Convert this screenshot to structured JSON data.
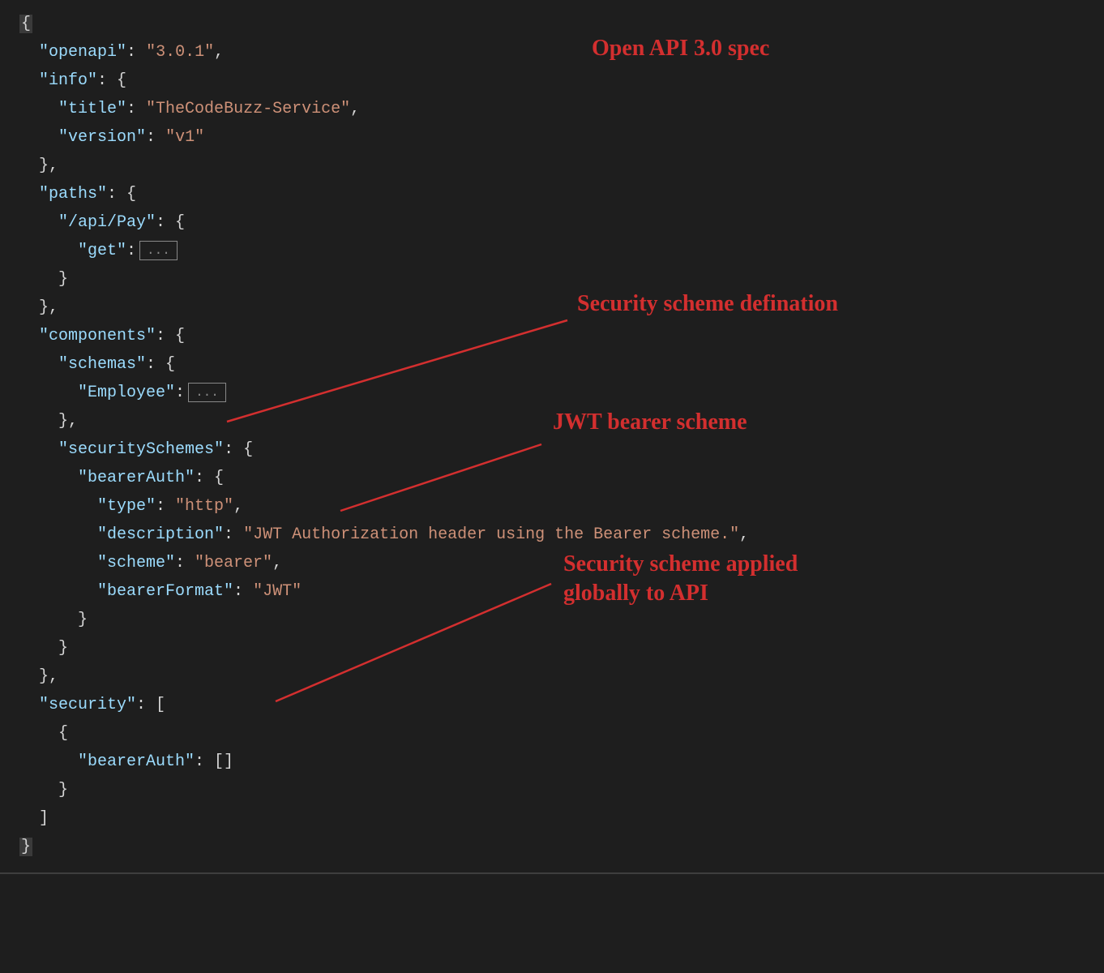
{
  "code": {
    "line1": "{",
    "line2_key": "\"openapi\"",
    "line2_val": "\"3.0.1\"",
    "line3_key": "\"info\"",
    "line4_key": "\"title\"",
    "line4_val": "\"TheCodeBuzz-Service\"",
    "line5_key": "\"version\"",
    "line5_val": "\"v1\"",
    "line7_key": "\"paths\"",
    "line8_key": "\"/api/Pay\"",
    "line9_key": "\"get\"",
    "collapsed": "...",
    "line12_key": "\"components\"",
    "line13_key": "\"schemas\"",
    "line14_key": "\"Employee\"",
    "line16_key": "\"securitySchemes\"",
    "line17_key": "\"bearerAuth\"",
    "line18_key": "\"type\"",
    "line18_val": "\"http\"",
    "line19_key": "\"description\"",
    "line19_val": "\"JWT Authorization header using the Bearer scheme.\"",
    "line20_key": "\"scheme\"",
    "line20_val": "\"bearer\"",
    "line21_key": "\"bearerFormat\"",
    "line21_val": "\"JWT\"",
    "line25_key": "\"security\"",
    "line27_key": "\"bearerAuth\""
  },
  "annotations": {
    "ann1": "Open API 3.0 spec",
    "ann2": "Security scheme defination",
    "ann3": "JWT bearer scheme",
    "ann4": "Security scheme applied globally to API"
  }
}
